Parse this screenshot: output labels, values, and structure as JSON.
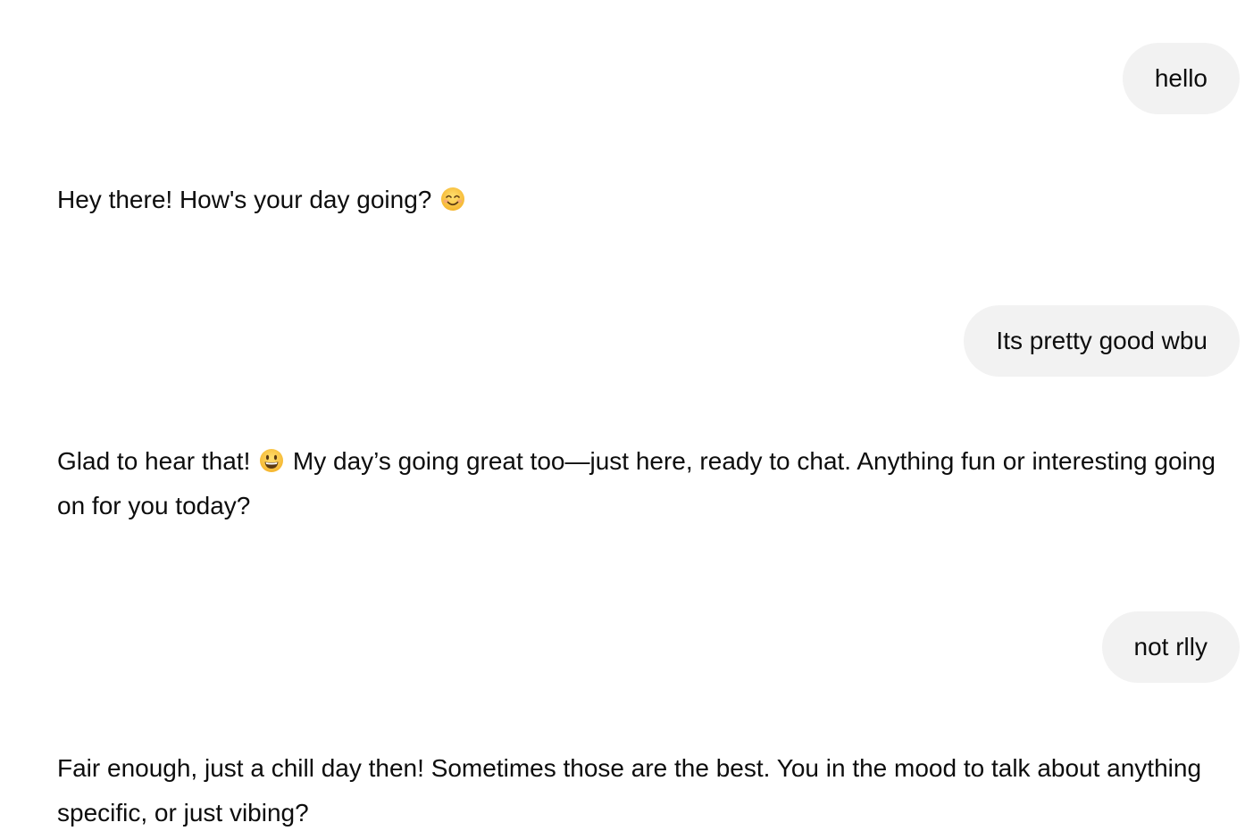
{
  "conversation": {
    "messages": [
      {
        "role": "user",
        "text": "hello"
      },
      {
        "role": "assistant",
        "parts": [
          "Hey there! How's your day going? ",
          ""
        ],
        "emoji": "smiling-face-with-smiling-eyes-icon"
      },
      {
        "role": "user",
        "text": "Its pretty good wbu"
      },
      {
        "role": "assistant",
        "parts": [
          "Glad to hear that! ",
          " My day’s going great too—just here, ready to chat. Anything fun or interesting going on for you today?"
        ],
        "emoji": "grinning-face-with-big-eyes-icon"
      },
      {
        "role": "user",
        "text": "not rlly"
      },
      {
        "role": "assistant",
        "text": "Fair enough, just a chill day then! Sometimes those are the best. You in the mood to talk about anything specific, or just vibing?"
      }
    ]
  },
  "colors": {
    "user_bubble_bg": "#f2f2f2",
    "text": "#0d0d0d",
    "emoji_face": "#f9c23c"
  }
}
